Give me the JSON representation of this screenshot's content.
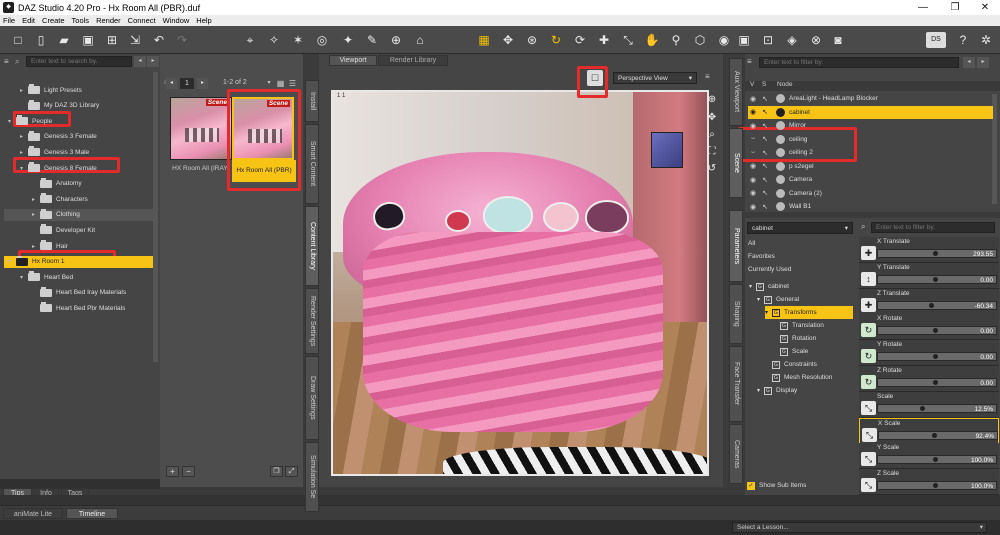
{
  "window": {
    "title": "DAZ Studio 4.20 Pro - Hx Room All  (PBR).duf",
    "app_icon": "daz-icon"
  },
  "menu": [
    "File",
    "Edit",
    "Create",
    "Tools",
    "Render",
    "Connect",
    "Window",
    "Help"
  ],
  "left_panel": {
    "search_placeholder": "Enter text to search by.",
    "tree": [
      {
        "label": "Light Presets",
        "depth": 1,
        "arrow": "▸"
      },
      {
        "label": "My DAZ 3D Library",
        "depth": 1,
        "arrow": ""
      },
      {
        "label": "People",
        "depth": 0,
        "arrow": "▾"
      },
      {
        "label": "Genesis 3 Female",
        "depth": 1,
        "arrow": "▸"
      },
      {
        "label": "Genesis 3 Male",
        "depth": 1,
        "arrow": "▸"
      },
      {
        "label": "Genesis 8 Female",
        "depth": 1,
        "arrow": "▾"
      },
      {
        "label": "Anatomy",
        "depth": 2,
        "arrow": ""
      },
      {
        "label": "Characters",
        "depth": 2,
        "arrow": "▸"
      },
      {
        "label": "Clothing",
        "depth": 2,
        "arrow": "▸"
      },
      {
        "label": "Developer Kit",
        "depth": 2,
        "arrow": ""
      },
      {
        "label": "Hair",
        "depth": 2,
        "arrow": "▸"
      },
      {
        "label": "Hx Room 1",
        "depth": 0,
        "arrow": "▾"
      },
      {
        "label": "Heart Bed",
        "depth": 1,
        "arrow": "▾"
      },
      {
        "label": "Heart Bed Iray Materials",
        "depth": 2,
        "arrow": ""
      },
      {
        "label": "Heart Bed Pbr Materials",
        "depth": 2,
        "arrow": ""
      }
    ],
    "tabs": [
      "Tips",
      "Info",
      "Tags"
    ]
  },
  "content_panel": {
    "page_num": "1",
    "count": "1-2 of 2",
    "items": [
      {
        "name": "HX Room All (IRAY)",
        "badge": "Scene"
      },
      {
        "name": "Hx Room All  (PBR)",
        "badge": "Scene"
      }
    ],
    "add": "+",
    "remove": "−"
  },
  "side_tabs_left": [
    "Install",
    "Smart Content",
    "Content Library",
    "Render Settings",
    "Draw Settings",
    "Simulation Se"
  ],
  "viewport": {
    "tabs": [
      "Viewport",
      "Render Library"
    ],
    "view": "Perspective View",
    "corner": "1   1"
  },
  "scene": {
    "filter_placeholder": "Enter text to filter by.",
    "cols": [
      "V",
      "S",
      "Node"
    ],
    "rows": [
      {
        "label": "AreaLight - HeadLamp Blocker",
        "selected": false
      },
      {
        "label": "cabinet",
        "selected": true
      },
      {
        "label": "Mirror",
        "selected": false
      },
      {
        "label": "ceiling",
        "selected": false
      },
      {
        "label": "ceiling 2",
        "selected": false
      },
      {
        "label": "p s2egel",
        "selected": false
      },
      {
        "label": "Camera",
        "selected": false
      },
      {
        "label": "Camera (2)",
        "selected": false
      },
      {
        "label": "Wall B1",
        "selected": false
      }
    ]
  },
  "side_tabs_right": [
    "Aux Viewport",
    "Scene",
    "Parameters",
    "Shaping",
    "Face Transfer",
    "Cameras"
  ],
  "parameters": {
    "node": "cabinet",
    "filter_placeholder": "Enter text to filter by.",
    "groups": [
      "All",
      "Favorites",
      "Currently Used"
    ],
    "tree": [
      {
        "label": "cabinet",
        "depth": 0
      },
      {
        "label": "General",
        "depth": 1
      },
      {
        "label": "Transforms",
        "depth": 2,
        "selected": true
      },
      {
        "label": "Translation",
        "depth": 3
      },
      {
        "label": "Rotation",
        "depth": 3
      },
      {
        "label": "Scale",
        "depth": 3
      },
      {
        "label": "Constraints",
        "depth": 2
      },
      {
        "label": "Mesh Resolution",
        "depth": 2
      },
      {
        "label": "Display",
        "depth": 1
      }
    ],
    "show_sub": "Show Sub Items",
    "props": [
      {
        "name": "X Translate",
        "value": "293.55",
        "pos": 0.5
      },
      {
        "name": "Y Translate",
        "value": "0.00",
        "pos": 0.5
      },
      {
        "name": "Z Translate",
        "value": "-60.34",
        "pos": 0.46
      },
      {
        "name": "X Rotate",
        "value": "0.00",
        "pos": 0.5
      },
      {
        "name": "Y Rotate",
        "value": "0.00",
        "pos": 0.5
      },
      {
        "name": "Z Rotate",
        "value": "0.00",
        "pos": 0.5
      },
      {
        "name": "Scale",
        "value": "12.5%",
        "pos": 0.38
      },
      {
        "name": "X Scale",
        "value": "92.4%",
        "pos": 0.48
      },
      {
        "name": "Y Scale",
        "value": "100.0%",
        "pos": 0.5
      },
      {
        "name": "Z Scale",
        "value": "100.0%",
        "pos": 0.5
      }
    ]
  },
  "bottom": {
    "tabs": [
      "aniMate Lite",
      "Timeline"
    ],
    "lesson": "Select a Lesson..."
  },
  "colors": {
    "selected": "#f7c415",
    "highlight": "#e32b2b"
  }
}
